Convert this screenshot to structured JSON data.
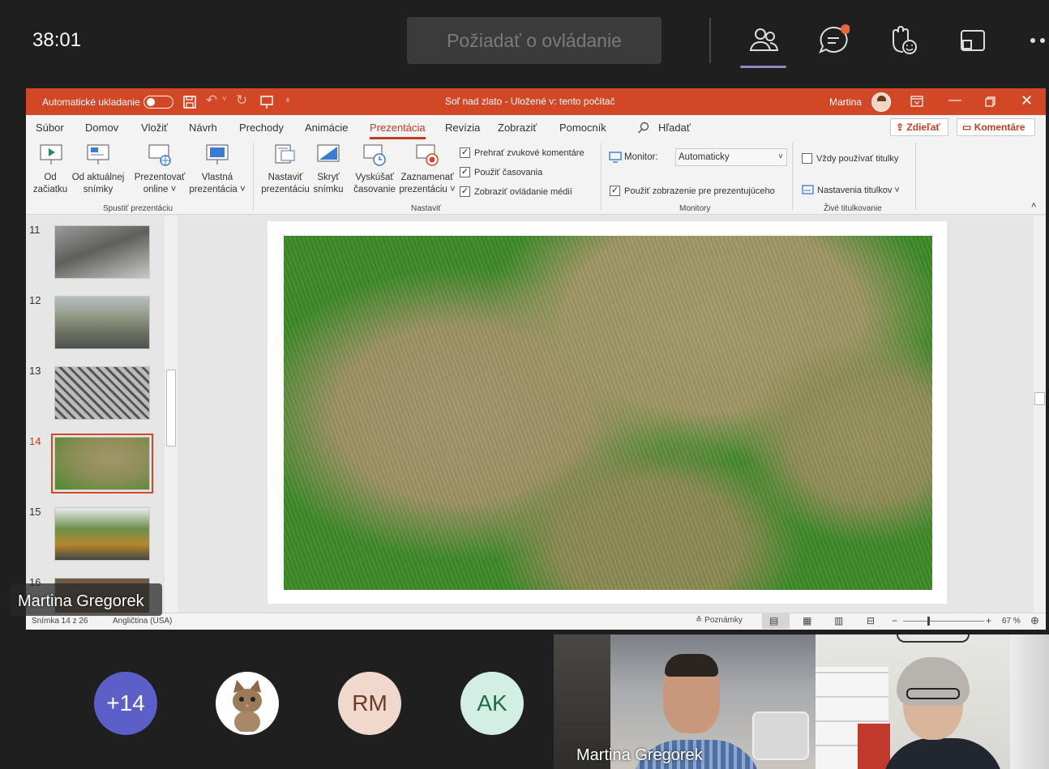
{
  "teams": {
    "timer": "38:01",
    "request_control": "Požiadať o ovládanie",
    "colors": {
      "accent": "#8b8cc7",
      "notification": "#f0643c"
    }
  },
  "powerpoint": {
    "autosave_label": "Automatické ukladanie",
    "doc_title": "Soľ nad zlato  -  Uložené v: tento počítač",
    "user_name": "Martina",
    "tabs": [
      "Súbor",
      "Domov",
      "Vložiť",
      "Návrh",
      "Prechody",
      "Animácie",
      "Prezentácia",
      "Revízia",
      "Zobraziť",
      "Pomocník"
    ],
    "active_tab": "Prezentácia",
    "search": "Hľadať",
    "share": "Zdieľať",
    "comments": "Komentáre",
    "ribbon": {
      "from_start": [
        "Od",
        "začiatku"
      ],
      "from_current": [
        "Od aktuálnej",
        "snímky"
      ],
      "present_online": [
        "Prezentovať",
        "online ˅"
      ],
      "custom_show": [
        "Vlastná",
        "prezentácia ˅"
      ],
      "group_start": "Spustiť prezentáciu",
      "setup": [
        "Nastaviť",
        "prezentáciu"
      ],
      "hide": [
        "Skryť",
        "snímku"
      ],
      "rehearse": [
        "Vyskúšať",
        "časovanie"
      ],
      "record": [
        "Zaznamenať",
        "prezentáciu ˅"
      ],
      "play_narrations": "Prehrať zvukové komentáre",
      "use_timings": "Použiť časovania",
      "show_media": "Zobraziť ovládanie médií",
      "group_setup": "Nastaviť",
      "monitor_label": "Monitor:",
      "monitor_value": "Automaticky",
      "presenter_view": "Použiť zobrazenie pre prezentujúceho",
      "group_monitors": "Monitory",
      "always_subtitles": "Vždy používať titulky",
      "subtitle_settings": "Nastavenia titulkov ˅",
      "group_captions": "Živé titulkovanie"
    },
    "thumb_numbers": [
      "11",
      "12",
      "13",
      "14",
      "15",
      "16"
    ],
    "status": {
      "slide": "Snímka 14 z 26",
      "language": "Angličtina (USA)",
      "notes": "Poznámky",
      "zoom": "67 %"
    }
  },
  "participants": {
    "presenter_name": "Martina Gregorek",
    "overflow": "+14",
    "avatar_rm": "RM",
    "avatar_ak": "AK",
    "video_name": "Martina Gregorek"
  }
}
